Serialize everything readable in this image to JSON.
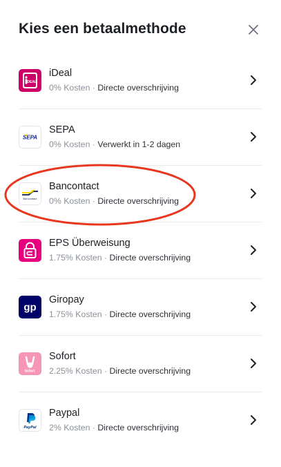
{
  "header": {
    "title": "Kies een betaalmethode"
  },
  "methods": [
    {
      "name": "iDeal",
      "cost": "0% Kosten",
      "separator": " · ",
      "desc": "Directe overschrijving",
      "logo": "ideal-logo"
    },
    {
      "name": "SEPA",
      "cost": "0% Kosten",
      "separator": " · ",
      "desc": "Verwerkt in 1-2 dagen",
      "logo": "sepa-logo"
    },
    {
      "name": "Bancontact",
      "cost": "0% Kosten",
      "separator": " · ",
      "desc": "Directe overschrijving",
      "logo": "bancontact-logo"
    },
    {
      "name": "EPS Überweisung",
      "cost": "1.75% Kosten",
      "separator": " · ",
      "desc": "Directe overschrijving",
      "logo": "eps-logo"
    },
    {
      "name": "Giropay",
      "cost": "1.75% Kosten",
      "separator": " · ",
      "desc": "Directe overschrijving",
      "logo": "giropay-logo"
    },
    {
      "name": "Sofort",
      "cost": "2.25% Kosten",
      "separator": " · ",
      "desc": "Directe overschrijving",
      "logo": "sofort-logo"
    },
    {
      "name": "Paypal",
      "cost": "2% Kosten",
      "separator": " · ",
      "desc": "Directe overschrijving",
      "logo": "paypal-logo"
    }
  ],
  "logo_text": {
    "ideal": "iDEAL",
    "sepa": "SEPA",
    "bancontact": "Bancontact",
    "giropay": "gp",
    "sofort": "Sofort.",
    "paypal": "PayPal"
  },
  "colors": {
    "ideal": "#cc0066",
    "eps": "#e6007e",
    "giropay": "#000268",
    "sofort": "#f596b4",
    "annotation": "#e8361f"
  }
}
